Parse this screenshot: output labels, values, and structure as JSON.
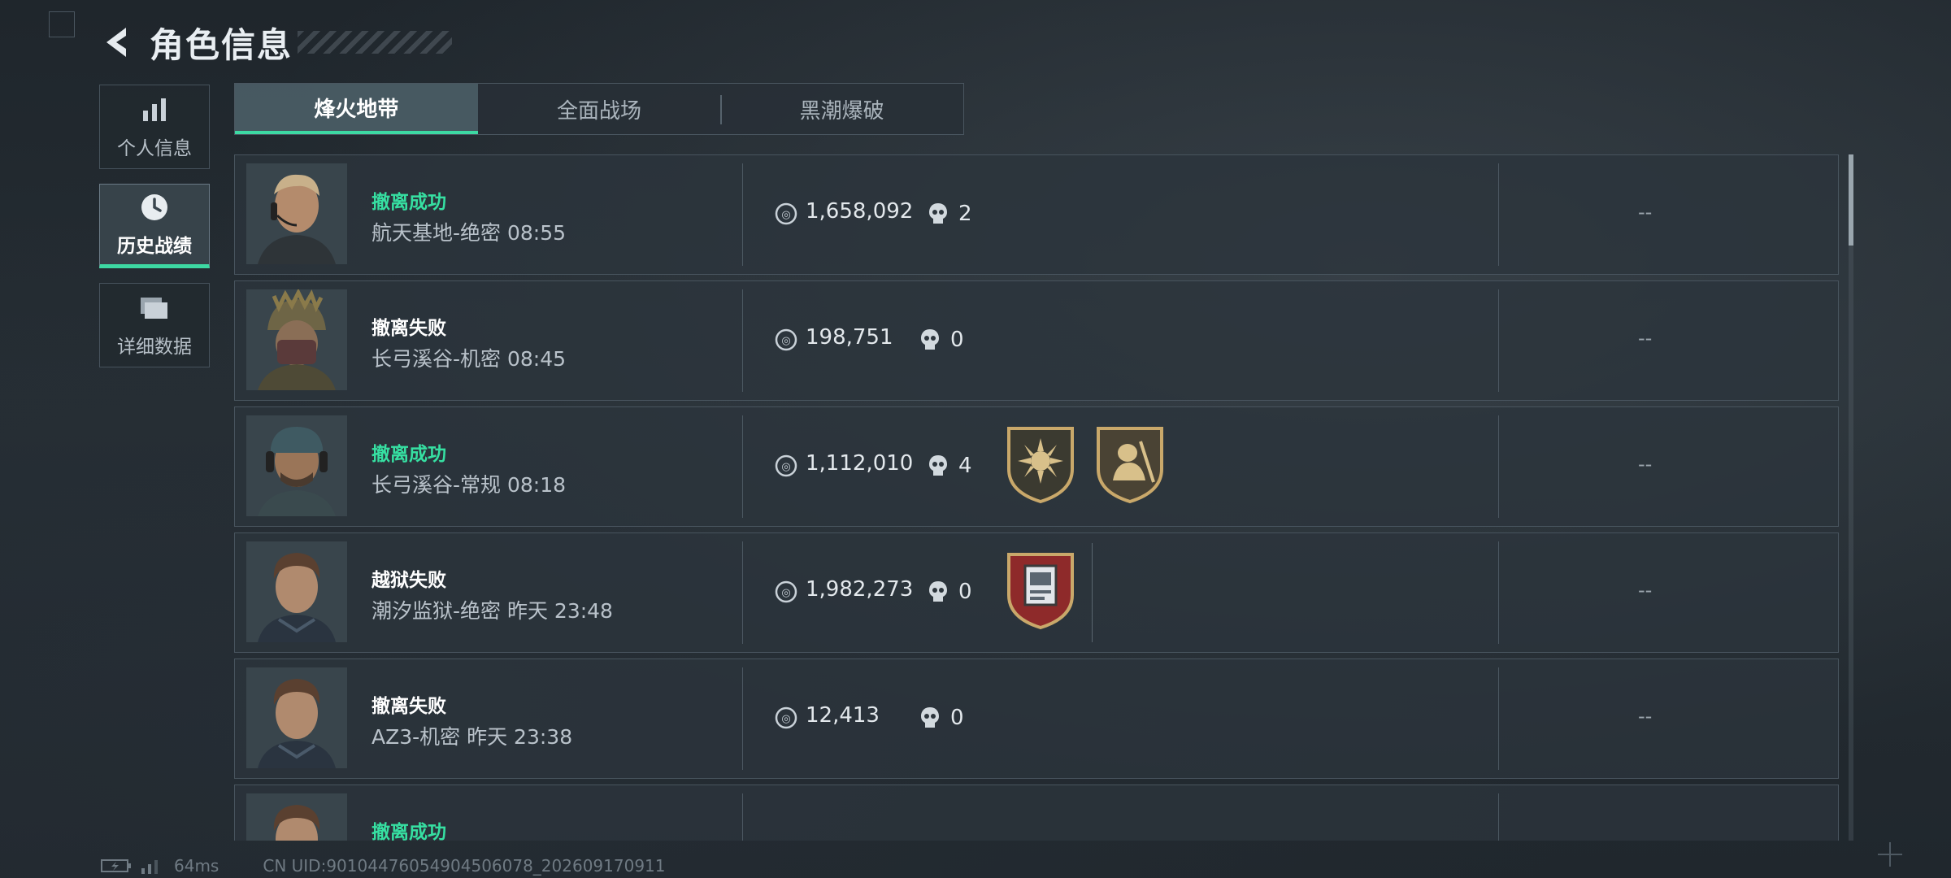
{
  "header": {
    "title": "角色信息"
  },
  "sidenav": [
    {
      "label": "个人信息",
      "icon": "bar-chart-icon",
      "active": false
    },
    {
      "label": "历史战绩",
      "icon": "clock-icon",
      "active": true
    },
    {
      "label": "详细数据",
      "icon": "folder-icon",
      "active": false
    }
  ],
  "tabs": [
    {
      "label": "烽火地带",
      "active": true
    },
    {
      "label": "全面战场",
      "active": false
    },
    {
      "label": "黑潮爆破",
      "active": false
    }
  ],
  "rows": [
    {
      "status": "撤离成功",
      "outcome": "success",
      "map": "航天基地-绝密 08:55",
      "value": "1,658,092",
      "kills": "2",
      "result": "--",
      "badges": []
    },
    {
      "status": "撤离失败",
      "outcome": "fail",
      "map": "长弓溪谷-机密 08:45",
      "value": "198,751",
      "kills": "0",
      "result": "--",
      "badges": []
    },
    {
      "status": "撤离成功",
      "outcome": "success",
      "map": "长弓溪谷-常规 08:18",
      "value": "1,112,010",
      "kills": "4",
      "result": "--",
      "badges": [
        "sun-emblem-badge-icon",
        "soldier-emblem-badge-icon"
      ]
    },
    {
      "status": "越狱失败",
      "outcome": "fail",
      "map": "潮汐监狱-绝密 昨天 23:48",
      "value": "1,982,273",
      "kills": "0",
      "result": "--",
      "badges": [
        "prison-card-badge-icon"
      ]
    },
    {
      "status": "撤离失败",
      "outcome": "fail",
      "map": "AZ3-机密 昨天 23:38",
      "value": "12,413",
      "kills": "0",
      "result": "--",
      "badges": []
    },
    {
      "status": "撤离成功",
      "outcome": "success",
      "map": "",
      "value": "",
      "kills": "",
      "result": "",
      "badges": []
    }
  ],
  "footer": {
    "ping": "64ms",
    "uid": "CN UID:9010447605490450607​8_202609170911"
  },
  "colors": {
    "accent": "#3dd9a3",
    "success": "#36e0a2",
    "fail": "#ffffff",
    "badge_gold": "#c9a86a",
    "badge_red": "#8e2a2a"
  }
}
